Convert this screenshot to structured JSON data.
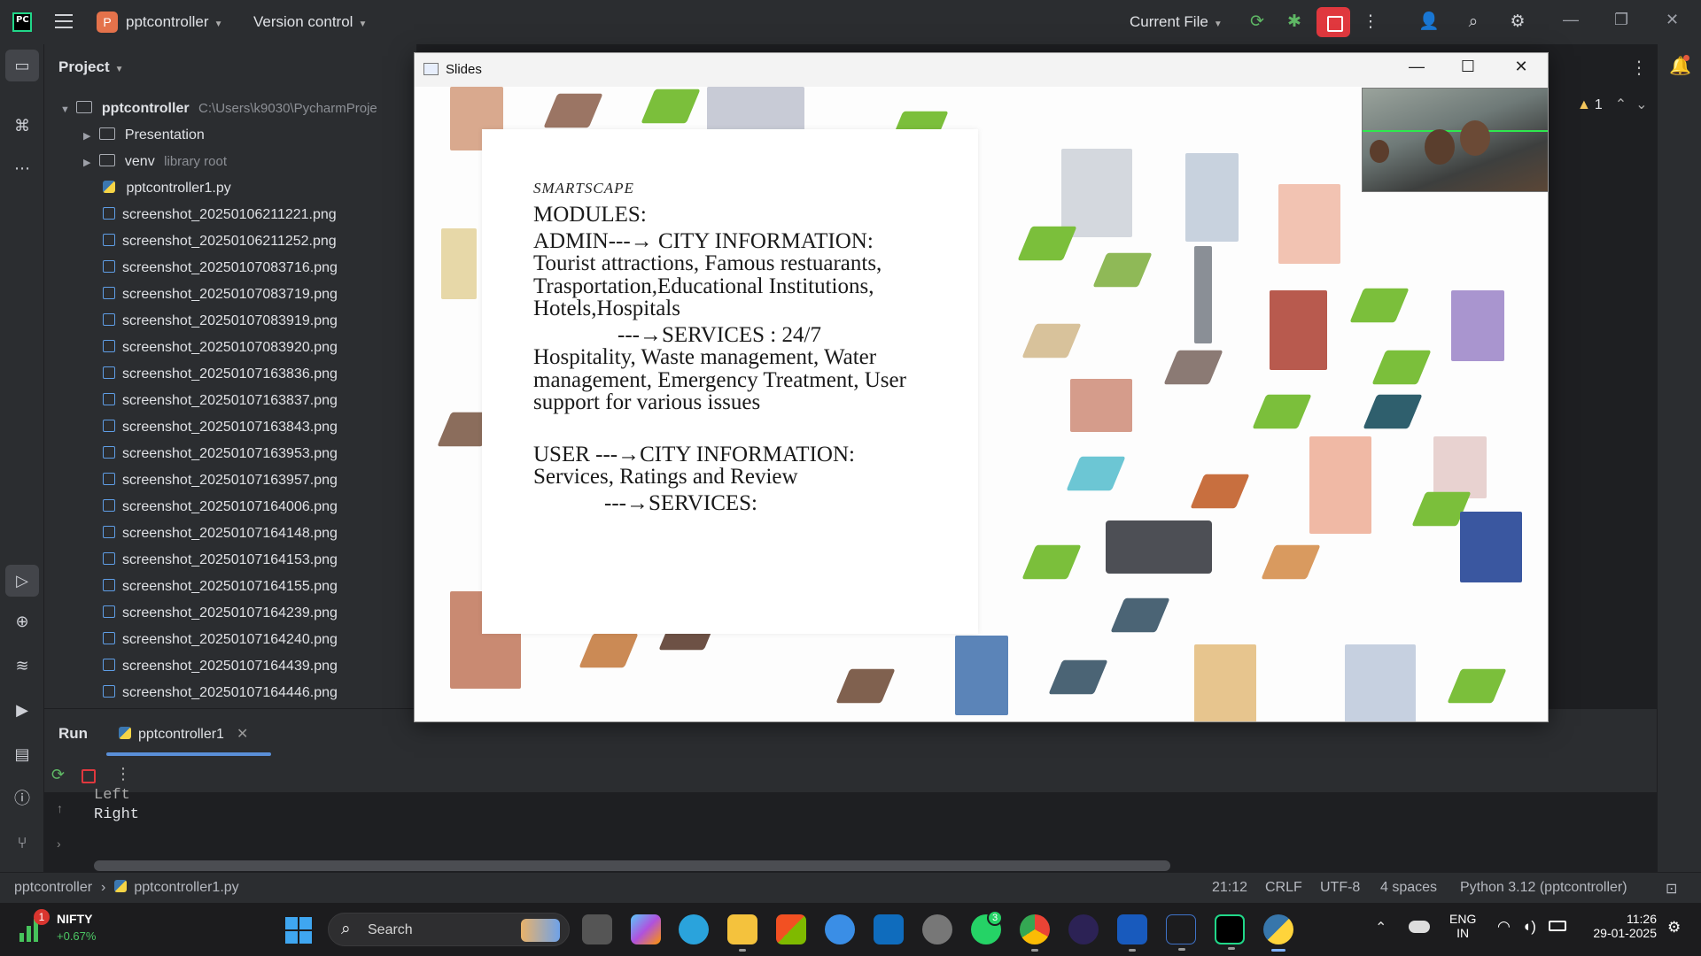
{
  "titlebar": {
    "project_initial": "P",
    "project_name": "pptcontroller",
    "version_control": "Version control",
    "run_config": "Current File"
  },
  "project_panel": {
    "header": "Project",
    "root": {
      "name": "pptcontroller",
      "path": "C:\\Users\\k9030\\PycharmProje"
    },
    "folders": [
      {
        "name": "Presentation",
        "tag": ""
      },
      {
        "name": "venv",
        "tag": "library root"
      }
    ],
    "files": [
      "pptcontroller1.py",
      "screenshot_20250106211221.png",
      "screenshot_20250106211252.png",
      "screenshot_20250107083716.png",
      "screenshot_20250107083719.png",
      "screenshot_20250107083919.png",
      "screenshot_20250107083920.png",
      "screenshot_20250107163836.png",
      "screenshot_20250107163837.png",
      "screenshot_20250107163843.png",
      "screenshot_20250107163953.png",
      "screenshot_20250107163957.png",
      "screenshot_20250107164006.png",
      "screenshot_20250107164148.png",
      "screenshot_20250107164153.png",
      "screenshot_20250107164155.png",
      "screenshot_20250107164239.png",
      "screenshot_20250107164240.png",
      "screenshot_20250107164439.png",
      "screenshot_20250107164446.png"
    ]
  },
  "editor": {
    "warning_count": "1"
  },
  "run_panel": {
    "title": "Run",
    "tab": "pptcontroller1",
    "console_lines": [
      "Left",
      "Right"
    ]
  },
  "statusbar": {
    "breadcrumb_project": "pptcontroller",
    "breadcrumb_file": "pptcontroller1.py",
    "position": "21:12",
    "line_sep": "CRLF",
    "encoding": "UTF-8",
    "indent": "4 spaces",
    "interpreter": "Python 3.12 (pptcontroller)"
  },
  "slides_window": {
    "title": "Slides",
    "brand": "SMARTSCAPE",
    "modules_heading": "MODULES:",
    "admin_line": "ADMIN---→ CITY INFORMATION: Tourist attractions, Famous restuarants, Trasportation,Educational Institutions, Hotels,Hospitals",
    "admin_services": "---→SERVICES :  24/7",
    "admin_services_detail": "Hospitality, Waste management, Water management, Emergency Treatment, User          support for various issues",
    "user_line": "USER ---→CITY INFORMATION: Services, Ratings and Review",
    "user_services": "---→SERVICES:"
  },
  "taskbar": {
    "stock_name": "NIFTY",
    "stock_change": "+0.67%",
    "stock_badge": "1",
    "search_label": "Search",
    "whatsapp_badge": "3",
    "lang_line1": "ENG",
    "lang_line2": "IN",
    "time": "11:26",
    "date": "29-01-2025"
  },
  "colors": {
    "ide_bg": "#2b2d30",
    "editor_bg": "#1e1f22",
    "stop_red": "#e0383e",
    "accent_blue": "#5a8fd8",
    "run_green": "#5fb865"
  }
}
